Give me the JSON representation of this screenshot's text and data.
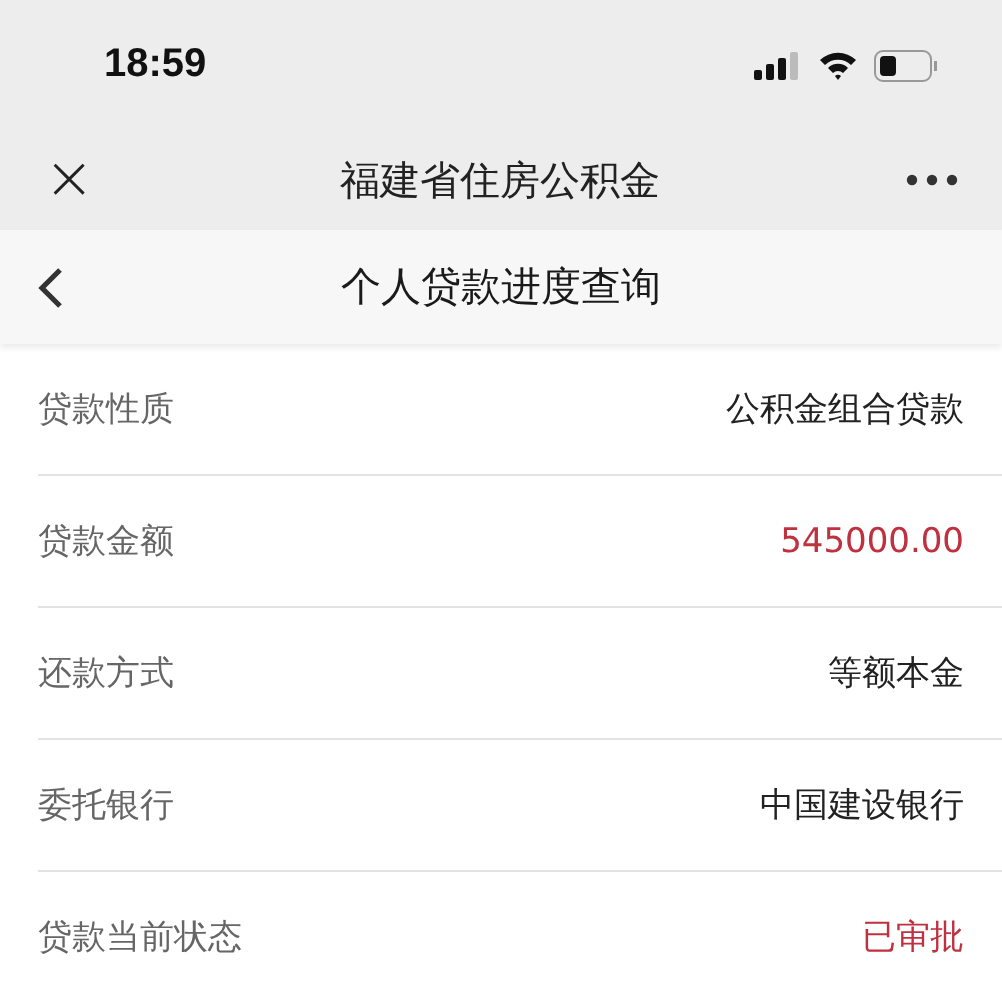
{
  "status_bar": {
    "time": "18:59"
  },
  "nav_bar": {
    "title": "福建省住房公积金",
    "close": "×"
  },
  "sub_header": {
    "title": "个人贷款进度查询"
  },
  "rows": [
    {
      "label": "贷款性质",
      "value": "公积金组合贷款",
      "highlighted": false
    },
    {
      "label": "贷款金额",
      "value": "545000.00",
      "highlighted": true
    },
    {
      "label": "还款方式",
      "value": "等额本金",
      "highlighted": false
    },
    {
      "label": "委托银行",
      "value": "中国建设银行",
      "highlighted": false
    },
    {
      "label": "贷款当前状态",
      "value": "已审批",
      "highlighted": true
    }
  ]
}
